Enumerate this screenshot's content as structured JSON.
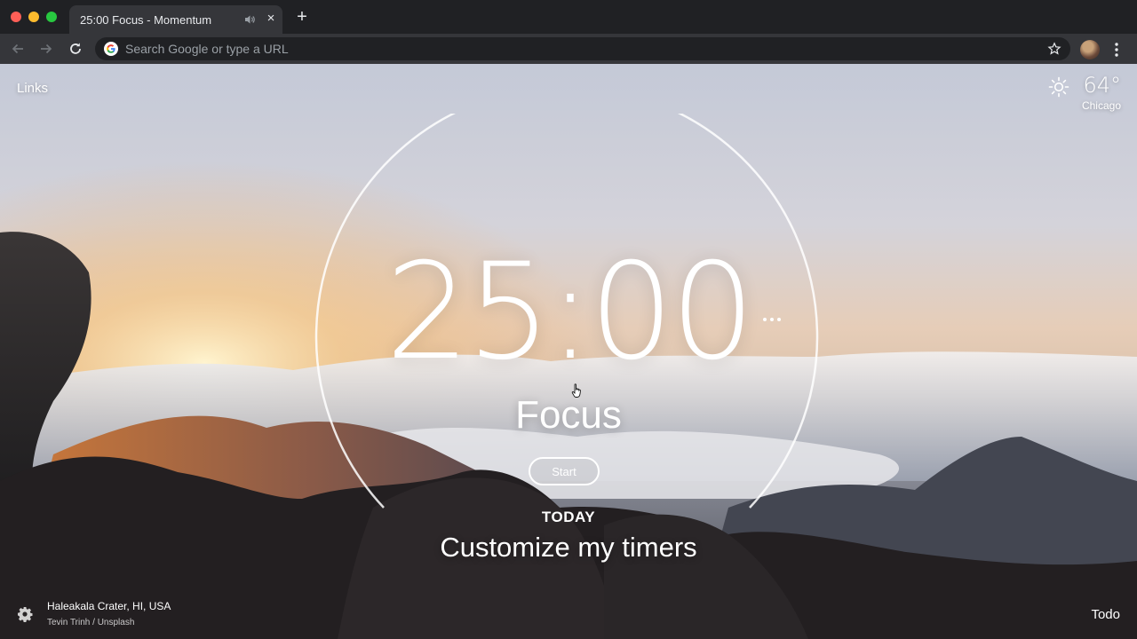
{
  "browser": {
    "tab": {
      "title": "25:00 Focus - Momentum",
      "close": "×"
    },
    "new_tab": "+",
    "omnibox": {
      "placeholder": "Search Google or type a URL",
      "value": ""
    }
  },
  "momentum": {
    "links_label": "Links",
    "weather": {
      "temperature": "64°",
      "city": "Chicago",
      "icon": "sun-icon"
    },
    "timer": {
      "time": "25:00",
      "mode": "Focus",
      "start_label": "Start",
      "menu_icon": "more-dots-icon"
    },
    "today": {
      "label": "TODAY",
      "focus": "Customize my timers"
    },
    "photo": {
      "location": "Haleakala Crater, HI, USA",
      "credit": "Tevin Trinh / Unsplash"
    },
    "todo_label": "Todo"
  },
  "colors": {
    "tab_bg": "#35363a",
    "chrome_bg": "#202124",
    "omnibox_bg": "#202124",
    "text_primary": "#ffffff"
  }
}
